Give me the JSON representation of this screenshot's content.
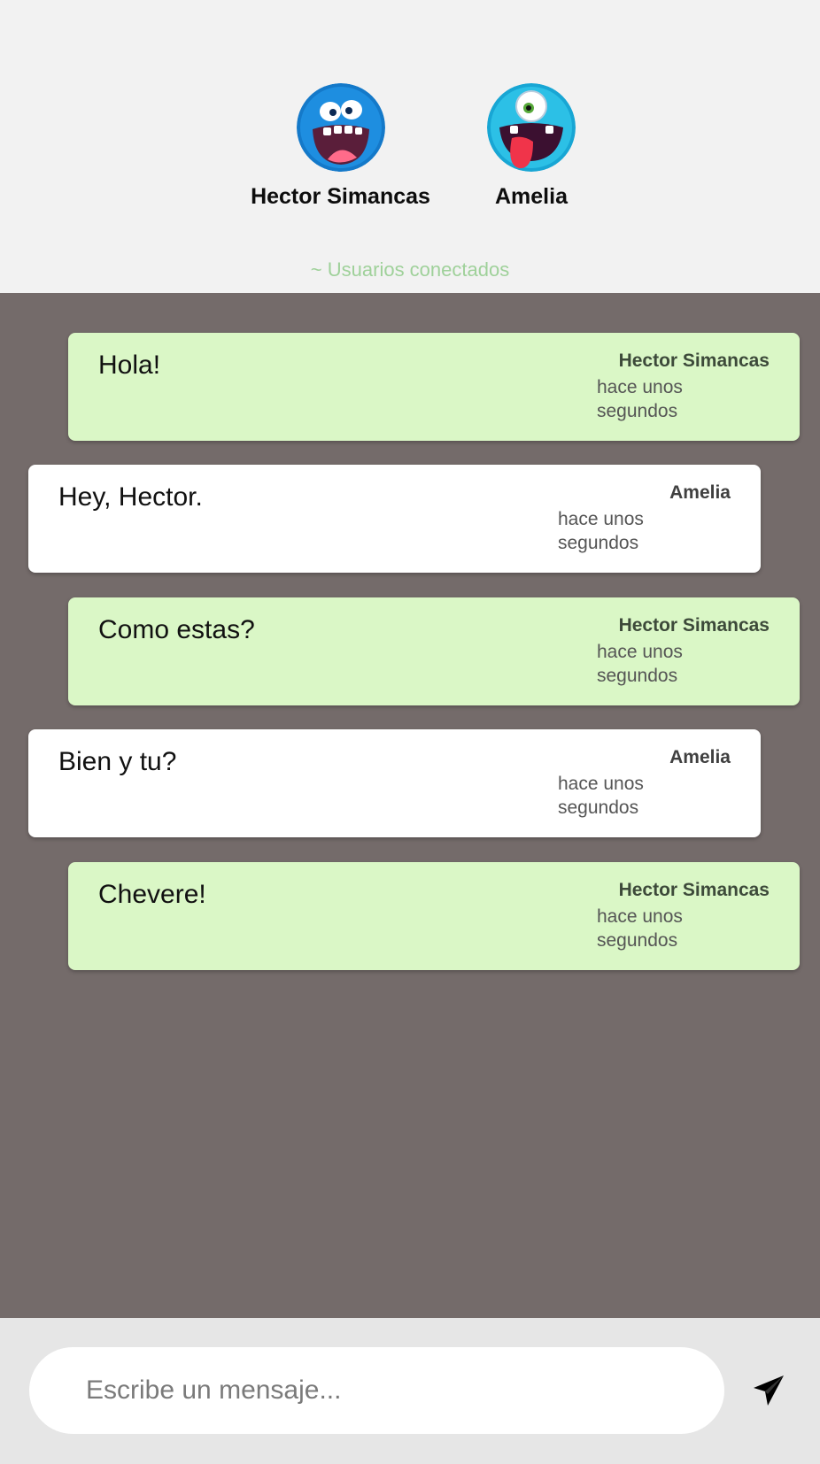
{
  "connected_users": {
    "users": [
      {
        "name": "Hector Simancas",
        "avatar": "blue-monster-avatar"
      },
      {
        "name": "Amelia",
        "avatar": "cyan-cyclops-monster-avatar"
      }
    ],
    "label": "~ Usuarios conectados"
  },
  "messages": [
    {
      "text": "Hola!",
      "author": "Hector Simancas",
      "time": "hace unos segundos",
      "own": true
    },
    {
      "text": "Hey, Hector.",
      "author": "Amelia",
      "time": "hace unos segundos",
      "own": false
    },
    {
      "text": "Como estas?",
      "author": "Hector Simancas",
      "time": "hace unos segundos",
      "own": true
    },
    {
      "text": "Bien y tu?",
      "author": "Amelia",
      "time": "hace unos segundos",
      "own": false
    },
    {
      "text": "Chevere!",
      "author": "Hector Simancas",
      "time": "hace unos segundos",
      "own": true
    }
  ],
  "composer": {
    "placeholder": "Escribe un mensaje...",
    "value": "",
    "send_icon": "paper-plane-icon"
  },
  "colors": {
    "header_bg": "#f2f2f2",
    "chat_bg": "#746b6a",
    "own_bubble": "#daf7c6",
    "other_bubble": "#ffffff",
    "connected_label": "#9fd19a",
    "footer_bg": "#e6e6e6"
  }
}
